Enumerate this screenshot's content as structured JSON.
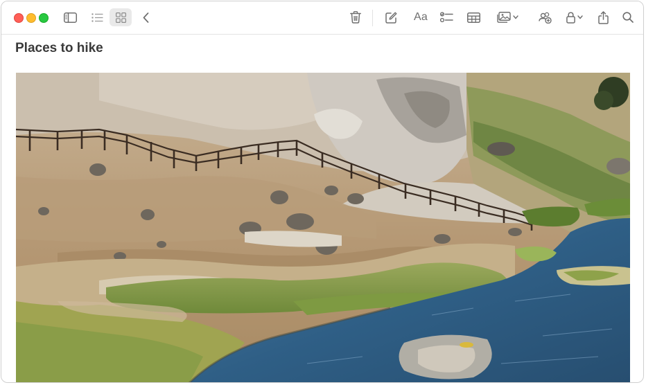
{
  "window": {
    "traffic_lights": {
      "close": "#ff5f57",
      "minimize": "#febc2e",
      "zoom": "#28c840"
    }
  },
  "toolbar": {
    "left": [
      {
        "name": "sidebar-toggle",
        "icon": "sidebar-icon"
      },
      {
        "name": "list-view",
        "icon": "list-icon"
      },
      {
        "name": "gallery-view",
        "icon": "grid-icon",
        "selected": true
      },
      {
        "name": "back",
        "icon": "chevron-left-icon"
      }
    ],
    "right": [
      {
        "name": "delete",
        "icon": "trash-icon"
      },
      {
        "name": "new-note",
        "icon": "compose-icon"
      },
      {
        "name": "format",
        "icon": "format-text-icon",
        "label": "Aa"
      },
      {
        "name": "checklist",
        "icon": "checklist-icon"
      },
      {
        "name": "table",
        "icon": "table-icon"
      },
      {
        "name": "media",
        "icon": "photo-icon",
        "has_menu": true
      },
      {
        "name": "collaborate",
        "icon": "collaborate-icon"
      },
      {
        "name": "lock",
        "icon": "lock-icon",
        "has_menu": true
      },
      {
        "name": "share",
        "icon": "share-icon"
      },
      {
        "name": "search",
        "icon": "search-icon"
      }
    ]
  },
  "note": {
    "title": "Places to hike",
    "attachment": {
      "type": "photo",
      "subject": "hot-creek-canyon-landscape-image"
    }
  }
}
